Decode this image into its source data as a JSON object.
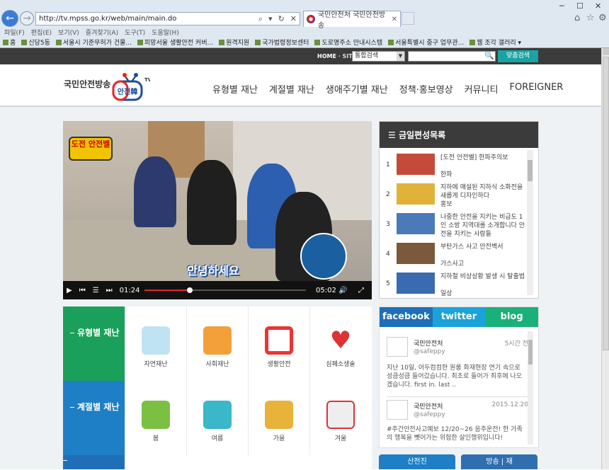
{
  "browser": {
    "url": "http://tv.mpss.go.kr/web/main/main.do",
    "tab_title": "국민안전처 국민안전방송",
    "window_controls": [
      "─",
      "☐",
      "✕"
    ],
    "menu": [
      "파일(F)",
      "편집(E)",
      "보기(V)",
      "즐겨찾기(A)",
      "도구(T)",
      "도움말(H)"
    ],
    "favorites": [
      "홈",
      "신당5동",
      "서울시 기준무허가 건물...",
      "피망서울 생활안전 커버...",
      "원격지원",
      "국가법령정보센터",
      "도로명주소 안내시스템",
      "서울특별시 중구 업무관...",
      "웹 조각 갤러리 ▾"
    ]
  },
  "topbar": {
    "home": "HOME",
    "sitemap": "SITEMAP",
    "search_select": "통합검색",
    "detail_search": "맞춤검색"
  },
  "header": {
    "logo_text": "국민안전방송",
    "logo_tv": "안전韓",
    "tv_mark": "TV",
    "nav": [
      "유형별 재난",
      "계절별 재난",
      "생애주기별 재난",
      "정책·홍보영상",
      "커뮤니티",
      "FOREIGNER"
    ]
  },
  "video": {
    "badge": "도전 안전벨",
    "caption": "안녕하세요",
    "current_time": "01:24",
    "duration": "05:02",
    "progress_fraction": 0.28
  },
  "schedule": {
    "title": "금일편성목록",
    "items": [
      {
        "num": "1",
        "title": "[도전 안전벨] 한파주의보",
        "sub": "한파"
      },
      {
        "num": "2",
        "title": "지하에 매설된 지하식 소화전을 새롭게 디자인하다",
        "sub": "홍보"
      },
      {
        "num": "3",
        "title": "나중한 안전을 지키는 비급도 1인 소방 지역대를 소개합니다 안전을 지키는 사람들",
        "sub": ""
      },
      {
        "num": "4",
        "title": "부탄가스 사고 안전벽서",
        "sub": "가스사고"
      },
      {
        "num": "5",
        "title": "지하철 비상상황 발생 시 탈출법",
        "sub": "일상"
      }
    ]
  },
  "categories": {
    "rows": [
      {
        "label": "유형별 재난",
        "color": "#1aa05a",
        "items": [
          "자연재난",
          "사회재난",
          "생활안전",
          "심폐소생술"
        ]
      },
      {
        "label": "계절별 재난",
        "color": "#1e7fc6",
        "items": [
          "봄",
          "여름",
          "가을",
          "겨울"
        ]
      }
    ]
  },
  "social": {
    "tabs": [
      {
        "label": "facebook",
        "color": "#1e6fb8"
      },
      {
        "label": "twitter",
        "color": "#1aa3d9"
      },
      {
        "label": "blog",
        "color": "#1ab07a"
      }
    ],
    "posts": [
      {
        "name": "국민안전처",
        "handle": "@safeppy",
        "time": "5시간 전",
        "body": "지난 10일, 어두컴컴한 원룸 화재현장 연기 속으로 성큼성큼 들어갔습니다. 최초로 들어가 최후에 나오겠습니다. first in. last .."
      },
      {
        "name": "국민안전처",
        "handle": "@safeppy",
        "time": "2015.12.20",
        "body": "#주간안전사고예보 12/20~26 음주운전! 한 가족의 행복을 뺏어가는 위험한 살인행위입니다!"
      }
    ]
  },
  "bottom": [
    "산전진",
    "방송 | 재"
  ]
}
